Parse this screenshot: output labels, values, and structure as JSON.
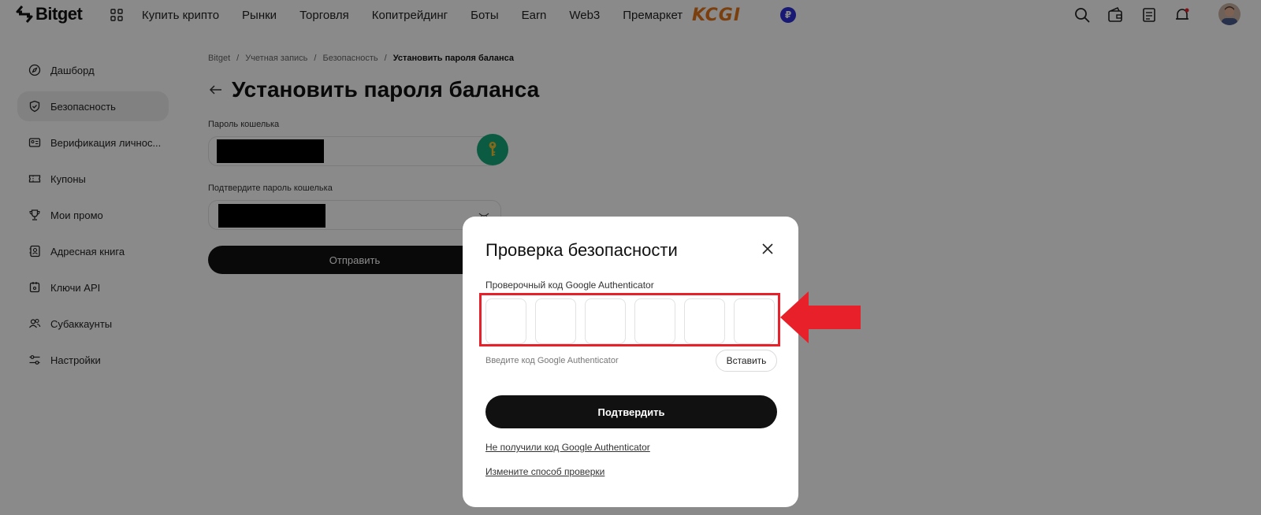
{
  "nav": {
    "logo": "Bitget",
    "menu": [
      "Купить крипто",
      "Рынки",
      "Торговля",
      "Копитрейдинг",
      "Боты",
      "Earn",
      "Web3",
      "Премаркет"
    ],
    "promo_logo": "KCGI",
    "currency_symbol": "₽"
  },
  "sidebar": {
    "items": [
      {
        "label": "Дашборд",
        "icon": "compass-icon"
      },
      {
        "label": "Безопасность",
        "icon": "shield-icon"
      },
      {
        "label": "Верификация личнос...",
        "icon": "id-card-icon"
      },
      {
        "label": "Купоны",
        "icon": "ticket-icon"
      },
      {
        "label": "Мои промо",
        "icon": "trophy-icon"
      },
      {
        "label": "Адресная книга",
        "icon": "address-book-icon"
      },
      {
        "label": "Ключи API",
        "icon": "api-key-icon"
      },
      {
        "label": "Субаккаунты",
        "icon": "users-icon"
      },
      {
        "label": "Настройки",
        "icon": "sliders-icon"
      }
    ]
  },
  "breadcrumb": [
    "Bitget",
    "Учетная запись",
    "Безопасность",
    "Установить пароля баланса"
  ],
  "page": {
    "title": "Установить пароля баланса",
    "field1_label": "Пароль кошелька",
    "field2_label": "Подтвердите пароль кошелька",
    "submit_label": "Отправить"
  },
  "modal": {
    "title": "Проверка безопасности",
    "code_label": "Проверочный код Google Authenticator",
    "code_digits": [
      "",
      "",
      "",
      "",
      "",
      ""
    ],
    "hint": "Введите код Google Authenticator",
    "paste_label": "Вставить",
    "confirm_label": "Подтвердить",
    "link_no_code": "Не получили код Google Authenticator",
    "link_change_method": "Измените способ проверки"
  },
  "colors": {
    "accent": "#111111",
    "highlight": "#e8202a",
    "promo": "#e3751b",
    "key_button": "#15a87c"
  }
}
